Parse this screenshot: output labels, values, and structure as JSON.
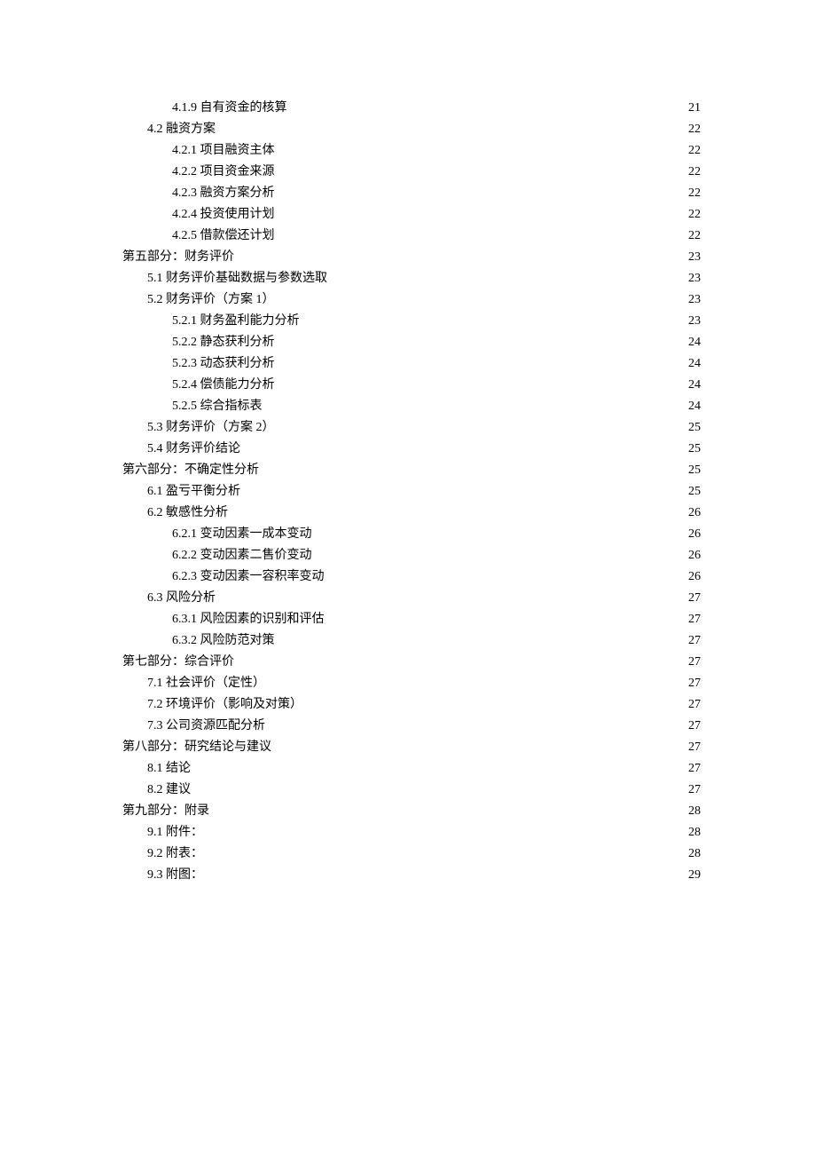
{
  "toc": [
    {
      "level": 2,
      "title": "4.1.9 自有资金的核算",
      "page": "21"
    },
    {
      "level": 1,
      "title": "4.2 融资方案",
      "page": "22"
    },
    {
      "level": 2,
      "title": "4.2.1 项目融资主体",
      "page": "22"
    },
    {
      "level": 2,
      "title": "4.2.2 项目资金来源",
      "page": "22"
    },
    {
      "level": 2,
      "title": "4.2.3 融资方案分析",
      "page": "22"
    },
    {
      "level": 2,
      "title": "4.2.4 投资使用计划",
      "page": "22"
    },
    {
      "level": 2,
      "title": "4.2.5 借款偿还计划",
      "page": "22"
    },
    {
      "level": 0,
      "title": "第五部分：财务评价",
      "page": "23"
    },
    {
      "level": 1,
      "title": "5.1 财务评价基础数据与参数选取",
      "page": "23"
    },
    {
      "level": 1,
      "title": "5.2 财务评价（方案 1）",
      "page": "23"
    },
    {
      "level": 2,
      "title": "5.2.1 财务盈利能力分析",
      "page": "23"
    },
    {
      "level": 2,
      "title": "5.2.2 静态获利分析",
      "page": "24"
    },
    {
      "level": 2,
      "title": "5.2.3 动态获利分析",
      "page": "24"
    },
    {
      "level": 2,
      "title": "5.2.4 偿债能力分析",
      "page": "24"
    },
    {
      "level": 2,
      "title": "5.2.5 综合指标表",
      "page": "24"
    },
    {
      "level": 1,
      "title": "5.3 财务评价（方案 2）",
      "page": "25"
    },
    {
      "level": 1,
      "title": "5.4 财务评价结论",
      "page": "25"
    },
    {
      "level": 0,
      "title": "第六部分：不确定性分析",
      "page": "25"
    },
    {
      "level": 1,
      "title": "6.1 盈亏平衡分析",
      "page": "25"
    },
    {
      "level": 1,
      "title": "6.2 敏感性分析",
      "page": "26"
    },
    {
      "level": 2,
      "title": "6.2.1 变动因素一成本变动",
      "page": "26"
    },
    {
      "level": 2,
      "title": "6.2.2 变动因素二售价变动",
      "page": "26"
    },
    {
      "level": 2,
      "title": "6.2.3 变动因素一容积率变动",
      "page": "26"
    },
    {
      "level": 1,
      "title": "6.3 风险分析",
      "page": "27"
    },
    {
      "level": 2,
      "title": "6.3.1 风险因素的识别和评估",
      "page": "27"
    },
    {
      "level": 2,
      "title": "6.3.2 风险防范对策",
      "page": "27"
    },
    {
      "level": 0,
      "title": "第七部分：综合评价",
      "page": "27"
    },
    {
      "level": 1,
      "title": "7.1 社会评价（定性）",
      "page": "27"
    },
    {
      "level": 1,
      "title": "7.2 环境评价（影响及对策）",
      "page": "27"
    },
    {
      "level": 1,
      "title": "7.3 公司资源匹配分析",
      "page": "27"
    },
    {
      "level": 0,
      "title": "第八部分：研究结论与建议",
      "page": "27"
    },
    {
      "level": 1,
      "title": "8.1 结论",
      "page": "27"
    },
    {
      "level": 1,
      "title": "8.2 建议",
      "page": "27"
    },
    {
      "level": 0,
      "title": "第九部分：附录",
      "page": "28"
    },
    {
      "level": 1,
      "title": "9.1 附件：",
      "page": "28"
    },
    {
      "level": 1,
      "title": "9.2 附表：",
      "page": "28"
    },
    {
      "level": 1,
      "title": "9.3 附图：",
      "page": "29"
    }
  ]
}
